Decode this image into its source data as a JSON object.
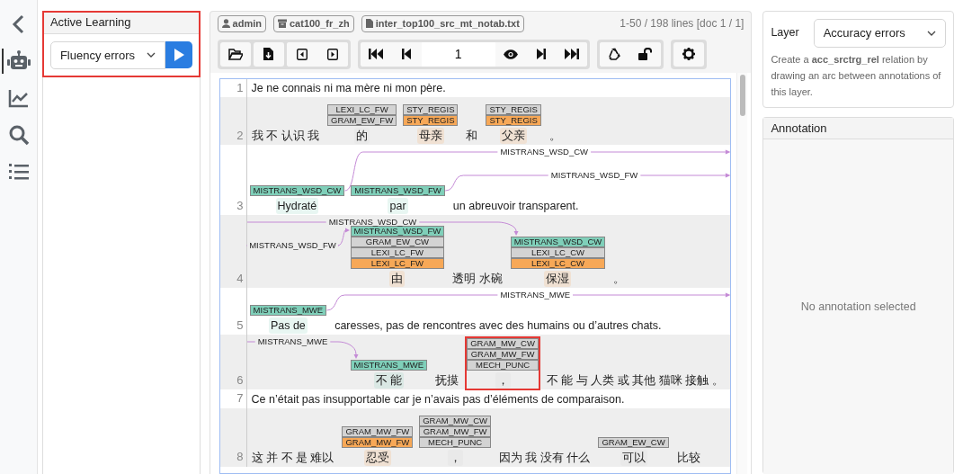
{
  "sidebar_tabs": [
    {
      "kind": "recommender",
      "selected": true
    },
    {
      "kind": "statistics",
      "selected": false
    },
    {
      "kind": "search",
      "selected": false
    },
    {
      "kind": "list",
      "selected": false
    }
  ],
  "active_learning": {
    "title": "Active Learning",
    "layer": "Fluency errors",
    "outlined": true
  },
  "document_info": {
    "user": "admin",
    "project": "cat100_fr_zh",
    "document": "inter_top100_src_mt_notab.txt",
    "position": "1-50 / 198 lines [doc 1 / 1]"
  },
  "toolbar": {
    "page": "1"
  },
  "lines": [
    {
      "number": "1",
      "shaded": false,
      "tokens": [
        {
          "text": "Je ne connais ni ma mère ni mon père."
        }
      ]
    },
    {
      "number": "2",
      "shaded": true,
      "tokens": [
        {
          "text": "我 不 认识 我"
        },
        {
          "text": "的",
          "labels": [
            {
              "text": "LEXI_LC_FW",
              "color": "#d3d3d3"
            },
            {
              "text": "GRAM_EW_FW",
              "color": "#d3d3d3"
            }
          ]
        },
        {
          "text": "母亲",
          "labels": [
            {
              "text": "STY_REGIS",
              "color": "#d3d3d3"
            },
            {
              "text": "STY_REGIS",
              "color": "#f7a857"
            }
          ]
        },
        {
          "text": "和"
        },
        {
          "text": "父亲",
          "labels": [
            {
              "text": "STY_REGIS",
              "color": "#d3d3d3"
            },
            {
              "text": "STY_REGIS",
              "color": "#f7a857"
            }
          ]
        },
        {
          "text": "。"
        }
      ]
    },
    {
      "number": "3",
      "shaded": false,
      "tokens": [
        {
          "text": "Hydraté",
          "labels": [
            {
              "text": "MISTRANS_WSD_CW",
              "color": "#7fcfb9"
            }
          ],
          "arc_out": "MISTRANS_WSD_CW"
        },
        {
          "text": "par",
          "labels": [
            {
              "text": "MISTRANS_WSD_FW",
              "color": "#7fcfb9"
            }
          ],
          "arc_out": "MISTRANS_WSD_FW"
        },
        {
          "text": "un abreuvoir transparent."
        }
      ]
    },
    {
      "number": "4",
      "shaded": true,
      "tokens": [
        {
          "text": "由",
          "labels": [
            {
              "text": "MISTRANS_WSD_FW",
              "color": "#7fcfb9"
            },
            {
              "text": "GRAM_EW_CW",
              "color": "#d3d3d3"
            },
            {
              "text": "LEXI_LC_FW",
              "color": "#d3d3d3"
            },
            {
              "text": "LEXI_LC_FW",
              "color": "#f7a857"
            }
          ],
          "arc_in": "MISTRANS_WSD_FW"
        },
        {
          "text": "透明 水碗"
        },
        {
          "text": "保湿",
          "labels": [
            {
              "text": "MISTRANS_WSD_CW",
              "color": "#7fcfb9"
            },
            {
              "text": "LEXI_LC_CW",
              "color": "#d3d3d3"
            },
            {
              "text": "LEXI_LC_CW",
              "color": "#f7a857"
            }
          ],
          "arc_in": "MISTRANS_WSD_CW"
        },
        {
          "text": "。"
        }
      ]
    },
    {
      "number": "5",
      "shaded": false,
      "tokens": [
        {
          "text": "Pas de",
          "labels": [
            {
              "text": "MISTRANS_MWE",
              "color": "#7fcfb9"
            }
          ],
          "arc_out": "MISTRANS_MWE"
        },
        {
          "text": "caresses, pas de rencontres avec des humains ou d’autres chats."
        }
      ]
    },
    {
      "number": "6",
      "shaded": true,
      "tokens": [
        {
          "text": "不 能",
          "labels": [
            {
              "text": "MISTRANS_MWE",
              "color": "#7fcfb9"
            }
          ],
          "arc_in": "MISTRANS_MWE"
        },
        {
          "text": "抚摸"
        },
        {
          "text": "，",
          "labels": [
            {
              "text": "GRAM_MW_CW",
              "color": "#d3d3d3"
            },
            {
              "text": "GRAM_MW_FW",
              "color": "#d3d3d3"
            },
            {
              "text": "MECH_PUNC",
              "color": "#d3d3d3"
            }
          ],
          "outlined": true
        },
        {
          "text": "不 能 与 人类 或 其他 猫咪 接触 。"
        }
      ]
    },
    {
      "number": "7",
      "shaded": false,
      "tokens": [
        {
          "text": "Ce n’était pas insupportable car je n’avais pas d’éléments de comparaison."
        }
      ]
    },
    {
      "number": "8",
      "shaded": true,
      "tokens": [
        {
          "text": "这 并 不 是 难以"
        },
        {
          "text": "忍受",
          "labels": [
            {
              "text": "GRAM_MW_FW",
              "color": "#d3d3d3"
            },
            {
              "text": "GRAM_MW_FW",
              "color": "#f7a857"
            }
          ]
        },
        {
          "text": "，",
          "labels": [
            {
              "text": "GRAM_MW_CW",
              "color": "#d3d3d3"
            },
            {
              "text": "GRAM_MW_FW",
              "color": "#d3d3d3"
            },
            {
              "text": "MECH_PUNC",
              "color": "#d3d3d3"
            }
          ]
        },
        {
          "text": "因为 我 没有 什么"
        },
        {
          "text": "可以",
          "labels": [
            {
              "text": "GRAM_EW_CW",
              "color": "#d3d3d3"
            }
          ]
        },
        {
          "text": "比较"
        }
      ]
    }
  ],
  "layer_panel": {
    "label": "Layer",
    "layer": "Accuracy errors",
    "help": "Create a **acc_srctrg_rel** relation by drawing an arc between annotations of this layer."
  },
  "annotation_panel": {
    "title": "Annotation",
    "empty_text": "No annotation selected"
  }
}
